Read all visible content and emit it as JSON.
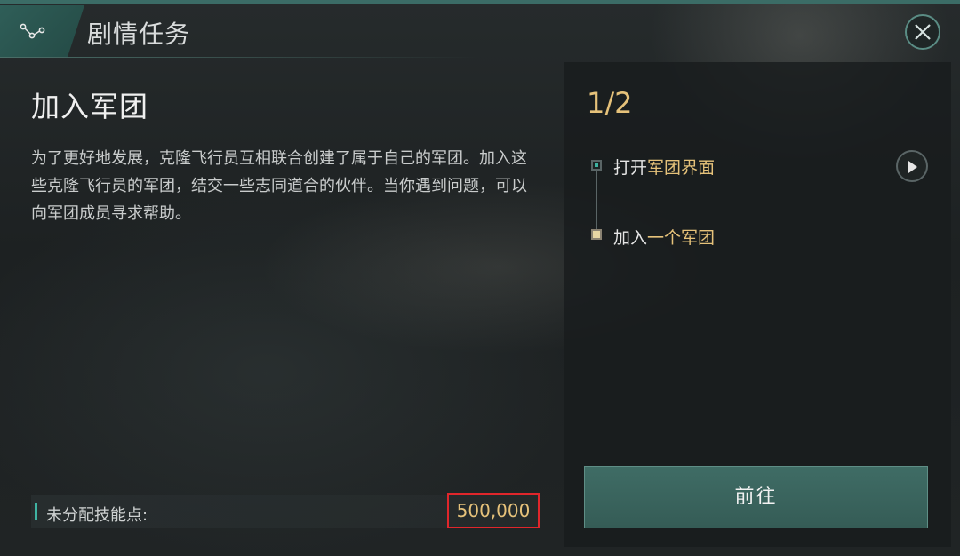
{
  "header": {
    "title": "剧情任务",
    "tab_icon": "network-nodes-icon",
    "close_icon": "close-icon"
  },
  "quest": {
    "title": "加入军团",
    "description": "为了更好地发展，克隆飞行员互相联合创建了属于自己的军团。加入这些克隆飞行员的军团，结交一些志同道合的伙伴。当你遇到问题，可以向军团成员寻求帮助。"
  },
  "skill_points": {
    "label": "未分配技能点:",
    "value": "500,000"
  },
  "objectives": {
    "progress": "1/2",
    "steps": [
      {
        "prefix": "打开",
        "highlight": "军团界面"
      },
      {
        "prefix": "加入",
        "highlight": "一个军团"
      }
    ],
    "play_icon": "play-icon"
  },
  "actions": {
    "go_label": "前往"
  },
  "colors": {
    "accent_teal": "#3fb3a2",
    "gold": "#e6c27a",
    "button": "#3f6c65",
    "highlight_box": "#e0262b"
  }
}
